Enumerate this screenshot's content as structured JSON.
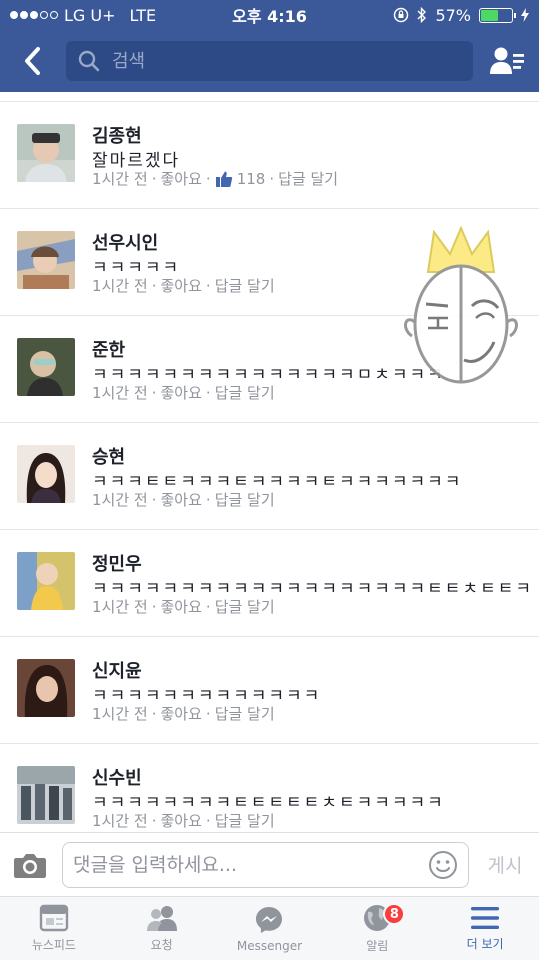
{
  "status": {
    "carrier": "LG U+",
    "network": "LTE",
    "time": "오후 4:16",
    "battery": "57%",
    "battery_level": 0.57,
    "signal_bars": 3
  },
  "navbar": {
    "search_placeholder": "검색",
    "back_icon": "chevron-left-icon",
    "friends_icon": "friend-requests-icon"
  },
  "comments": [
    {
      "name": "김종현",
      "text": "잘마르겠다",
      "time": "1시간 전",
      "like_label": "좋아요",
      "like_count": "118",
      "reply_label": "답글 달기",
      "avatar_color": "#9fb0a5"
    },
    {
      "name": "선우시인",
      "text": "ㅋㅋㅋㅋㅋ",
      "time": "1시간 전",
      "like_label": "좋아요",
      "like_count": "",
      "reply_label": "답글 달기",
      "avatar_color": "#c7a27e"
    },
    {
      "name": "준한",
      "text": "ㅋㅋㅋㅋㅋㅋㅋㅋㅋㅋㅋㅋㅋㅋㅋㅁㅊㅋㅋㅋ",
      "time": "1시간 전",
      "like_label": "좋아요",
      "like_count": "",
      "reply_label": "답글 달기",
      "avatar_color": "#5c6b4e"
    },
    {
      "name": "승현",
      "text": "ㅋㅋㅋㅌㅌㅋㅋㅋㅌㅋㅋㅋㅋㅌㅋㅋㅋㅋㅋㅋㅋ",
      "time": "1시간 전",
      "like_label": "좋아요",
      "like_count": "",
      "reply_label": "답글 달기",
      "avatar_color": "#3a2a28"
    },
    {
      "name": "정민우",
      "text": "ㅋㅋㅋㅋㅋㅋㅋㅋㅋㅋㅋㅋㅋㅋㅋㅋㅋㅋㅋㅌㅌㅊㅌㅌㅋ",
      "time": "1시간 전",
      "like_label": "좋아요",
      "like_count": "",
      "reply_label": "답글 달기",
      "avatar_color": "#c8b24a"
    },
    {
      "name": "신지윤",
      "text": "ㅋㅋㅋㅋㅋㅋㅋㅋㅋㅋㅋㅋㅋ",
      "time": "1시간 전",
      "like_label": "좋아요",
      "like_count": "",
      "reply_label": "답글 달기",
      "avatar_color": "#5b3a2f"
    },
    {
      "name": "신수빈",
      "text": "ㅋㅋㅋㅋㅋㅋㅋㅋㅌㅌㅌㅌㅌㅊㅌㅋㅋㅋㅋㅋ",
      "time": "1시간 전",
      "like_label": "좋아요",
      "like_count": "",
      "reply_label": "답글 달기",
      "avatar_color": "#6f7c82"
    }
  ],
  "composer": {
    "placeholder": "댓글을 입력하세요...",
    "post_label": "게시"
  },
  "tabbar": {
    "tabs": [
      {
        "label": "뉴스피드",
        "icon": "news-feed-icon",
        "active": false
      },
      {
        "label": "요청",
        "icon": "friend-requests-icon",
        "active": false
      },
      {
        "label": "Messenger",
        "icon": "messenger-icon",
        "active": false
      },
      {
        "label": "알림",
        "icon": "globe-icon",
        "active": false,
        "badge": "8"
      },
      {
        "label": "더 보기",
        "icon": "menu-icon",
        "active": true
      }
    ]
  },
  "colors": {
    "brand": "#3b5998",
    "active_tab": "#4267b2",
    "badge": "#fa3e3e"
  }
}
